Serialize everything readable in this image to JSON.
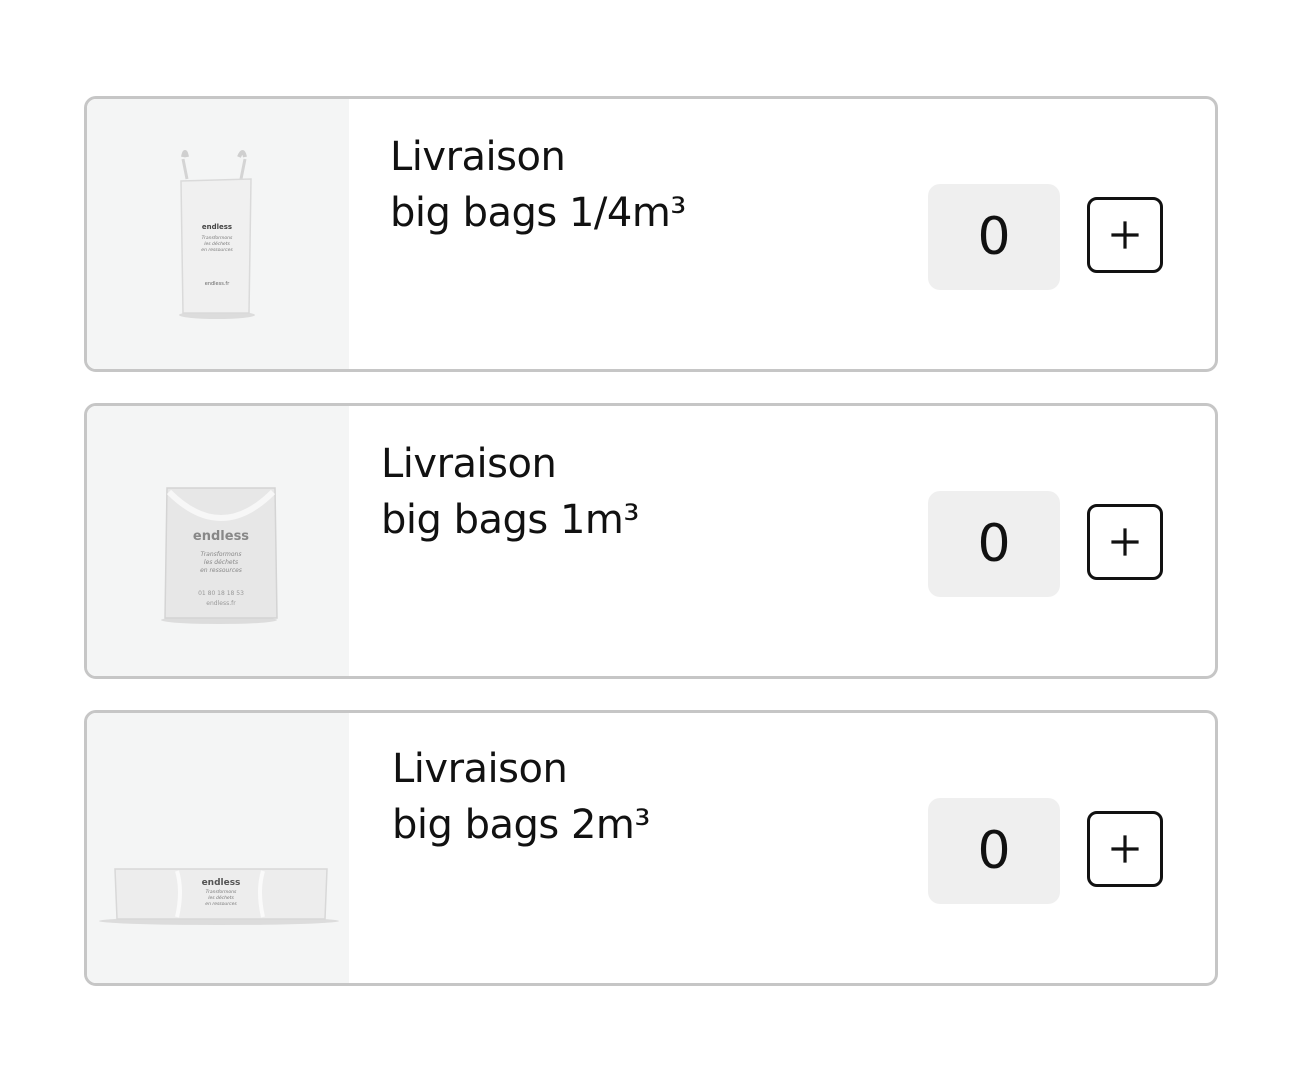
{
  "products": [
    {
      "title_line1": "Livraison",
      "title_line2": "big bags 1/4m³",
      "quantity": "0",
      "image": "big-bag-quarter-m3",
      "brand": "endless",
      "tagline": "Transformons les déchets en ressources",
      "website": "endless.fr"
    },
    {
      "title_line1": "Livraison",
      "title_line2": "big bags 1m³",
      "quantity": "0",
      "image": "big-bag-1m3",
      "brand": "endless",
      "tagline": "Transformons les déchets en ressources",
      "phone": "01 80 18 18 53",
      "website": "endless.fr"
    },
    {
      "title_line1": "Livraison",
      "title_line2": "big bags 2m³",
      "quantity": "0",
      "image": "big-bag-2m3",
      "brand": "endless",
      "tagline": "Transformons les déchets en ressources"
    }
  ],
  "icons": {
    "increment": "plus-icon"
  },
  "colors": {
    "card_border": "#c6c6c6",
    "thumb_bg": "#f4f5f5",
    "qty_bg": "#efefef",
    "text": "#111111"
  }
}
